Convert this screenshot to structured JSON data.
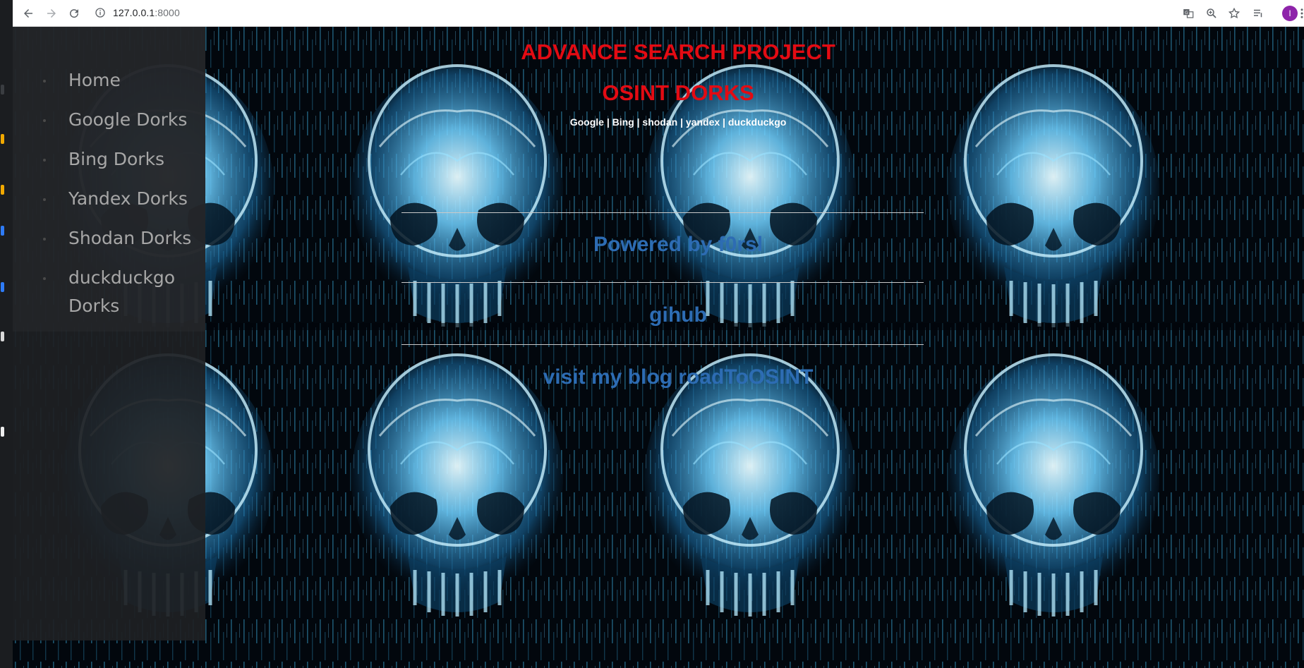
{
  "browser": {
    "url_host": "127.0.0.1",
    "url_port": ":8000",
    "profile_initial": "I",
    "icons": [
      "back-icon",
      "forward-icon",
      "reload-icon",
      "site-info-icon",
      "translate-icon",
      "zoom-icon",
      "star-icon",
      "reading-list-icon",
      "menu-icon"
    ]
  },
  "sidebar": {
    "items": [
      {
        "label": "Home"
      },
      {
        "label": "Google Dorks"
      },
      {
        "label": "Bing Dorks"
      },
      {
        "label": "Yandex Dorks"
      },
      {
        "label": "Shodan Dorks"
      },
      {
        "label": "duckduckgo Dorks"
      }
    ]
  },
  "header": {
    "title": "ADVANCE SEARCH PROJECT",
    "subtitle_title": "OSINT DORKS",
    "engines": "Google | Bing | shodan | yandex | duckduckgo"
  },
  "links": {
    "powered": "Powered by f0rsl",
    "github": "gihub",
    "blog": "visit my blog roadToOSINT"
  },
  "colors": {
    "title_red": "#e30b13",
    "link_blue": "#2d6cb3",
    "skull_glow": "#7fd4ff"
  }
}
